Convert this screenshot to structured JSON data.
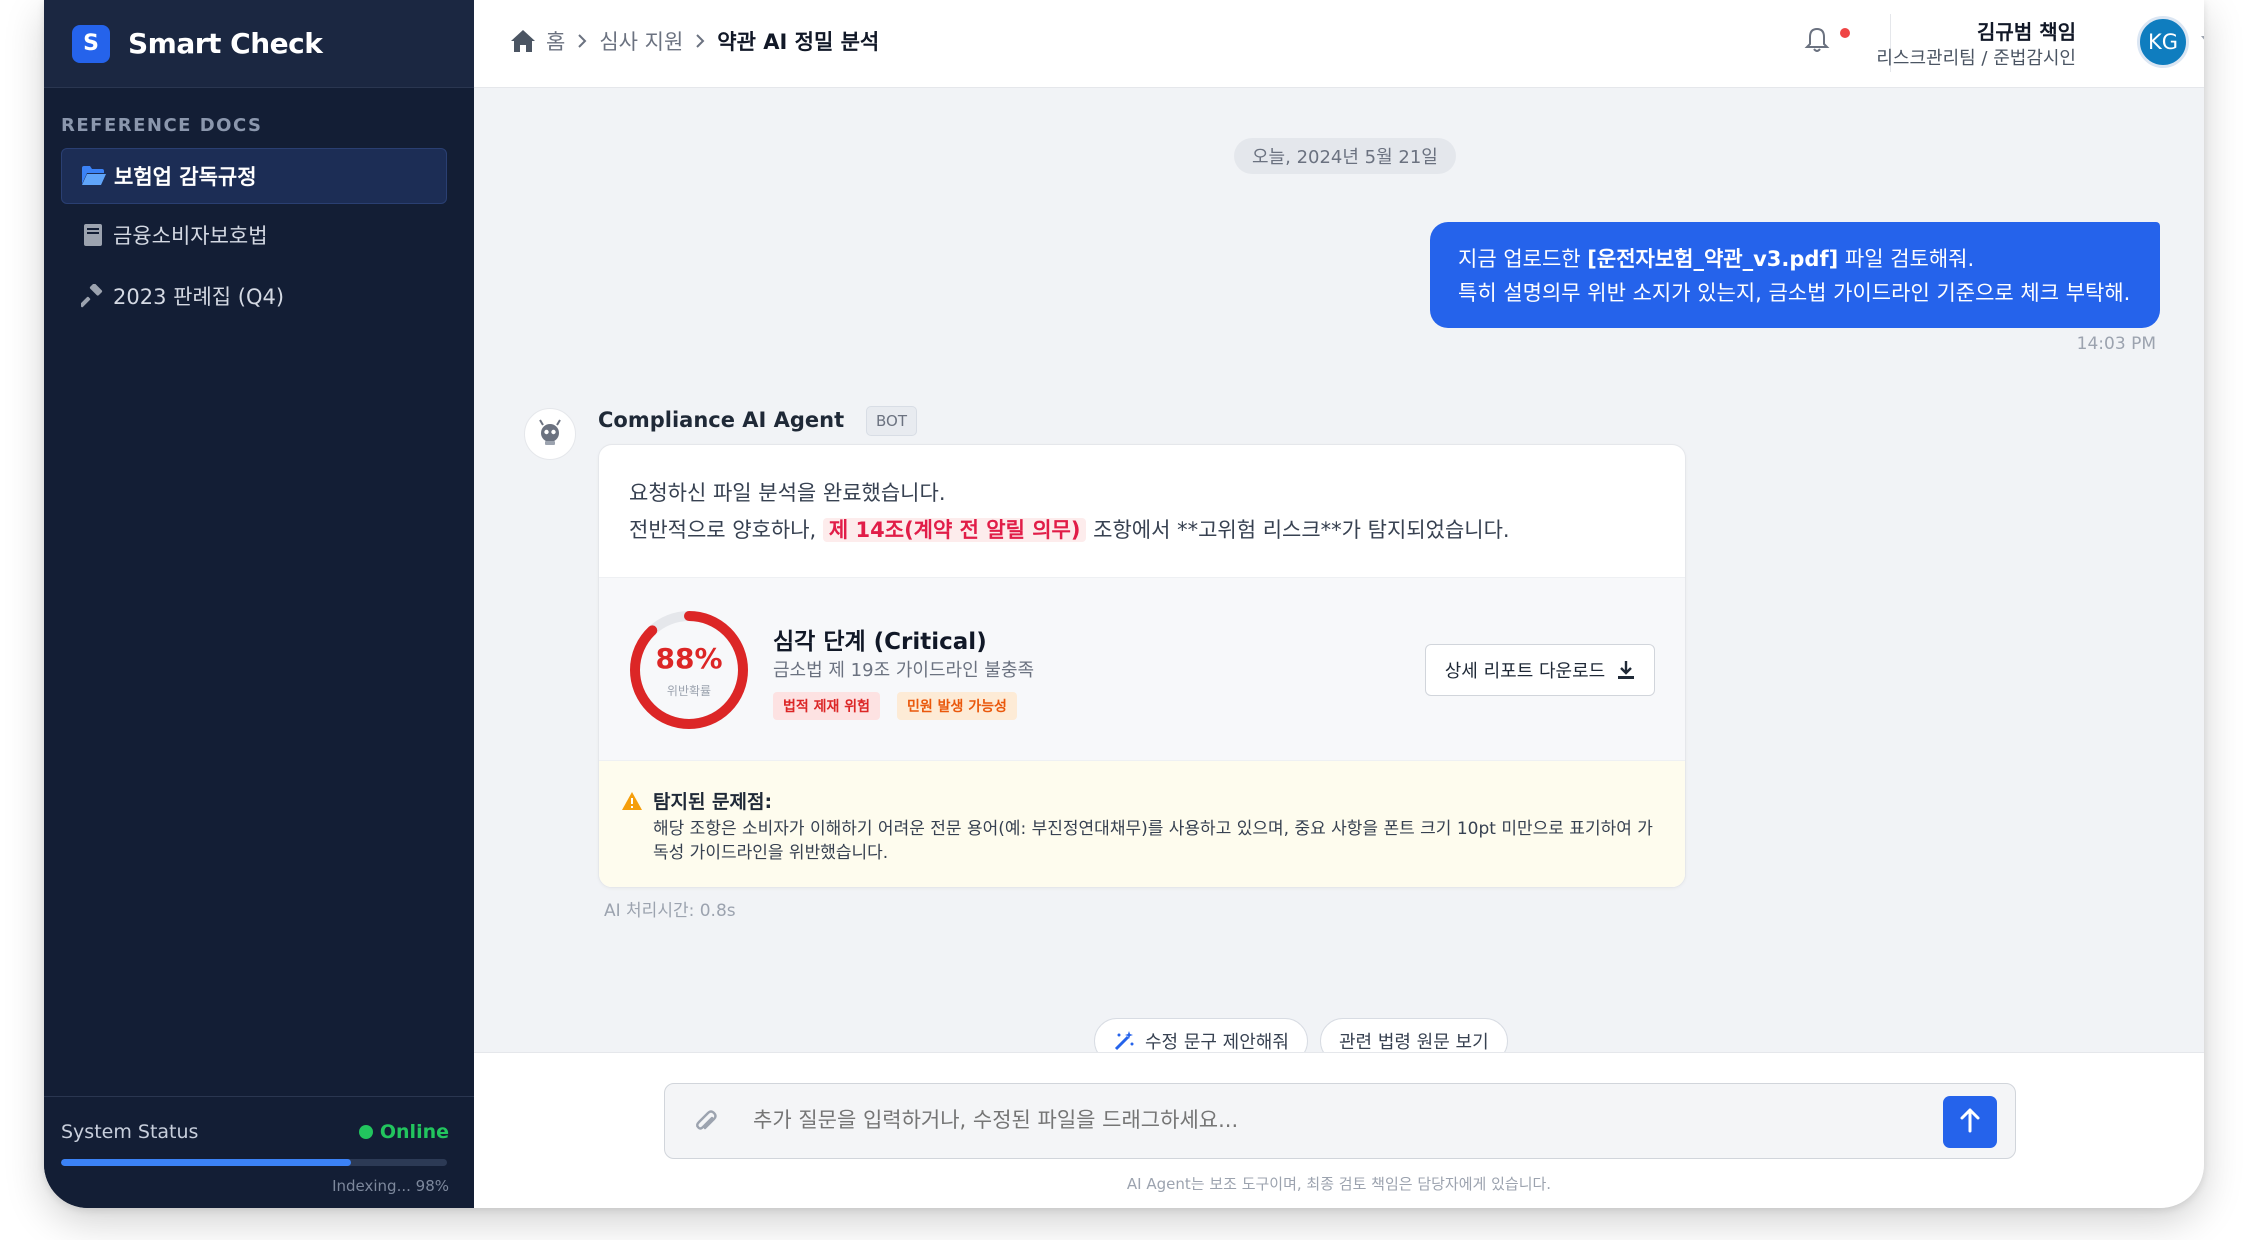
{
  "app": {
    "logo_letter": "S",
    "title": "Smart Check"
  },
  "sidebar": {
    "section_label": "REFERENCE DOCS",
    "items": [
      {
        "label": "보험업 감독규정",
        "icon": "folder-open-icon",
        "active": true
      },
      {
        "label": "금융소비자보호법",
        "icon": "book-icon",
        "active": false
      },
      {
        "label": "2023 판례집 (Q4)",
        "icon": "gavel-icon",
        "active": false
      }
    ],
    "status": {
      "label": "System Status",
      "value": "Online",
      "indexing_text": "Indexing... 98%",
      "indexing_progress": 0.75
    }
  },
  "breadcrumb": {
    "home": "홈",
    "parent": "심사 지원",
    "current": "약관 AI 정밀 분석"
  },
  "user": {
    "name": "김규범 책임",
    "team": "리스크관리팀 / 준법감시인",
    "initials": "KG"
  },
  "chat": {
    "date": "오늘, 2024년 5월 21일",
    "user_message": {
      "line1_prefix": "지금 업로드한 ",
      "line1_file": "[운전자보험_약관_v3.pdf]",
      "line1_suffix": " 파일 검토해줘.",
      "line2": "특히 설명의무 위반 소지가 있는지, 금소법 가이드라인 기준으로 체크 부탁해.",
      "time": "14:03 PM"
    },
    "bot": {
      "name": "Compliance AI Agent",
      "badge": "BOT",
      "line1": "요청하신 파일 분석을 완료했습니다.",
      "line2_prefix": "전반적으로 양호하나, ",
      "line2_highlight": "제 14조(계약 전 알릴 의무)",
      "line2_suffix": " 조항에서 **고위험 리스크**가 탐지되었습니다.",
      "risk": {
        "percent_text": "88%",
        "percent_value": 88,
        "gauge_label": "위반확률",
        "title": "심각 단계 (Critical)",
        "subtitle": "금소법 제 19조 가이드라인 불충족",
        "tags": [
          "법적 제재 위험",
          "민원 발생 가능성"
        ],
        "download_label": "상세 리포트 다운로드"
      },
      "issue": {
        "title": "탐지된 문제점:",
        "body": "해당 조항은 소비자가 이해하기 어려운 전문 용어(예: 부진정연대채무)를 사용하고 있으며, 중요 사항을 폰트 크기 10pt 미만으로 표기하여 가독성 가이드라인을 위반했습니다."
      },
      "processing_time": "AI 처리시간: 0.8s"
    }
  },
  "suggestions": [
    "수정 문구 제안해줘",
    "관련 법령 원문 보기"
  ],
  "composer": {
    "placeholder": "추가 질문을 입력하거나, 수정된 파일을 드래그하세요...",
    "disclaimer": "AI Agent는 보조 도구이며, 최종 검토 책임은 담당자에게 있습니다."
  },
  "colors": {
    "accent": "#2563eb",
    "sidebar_bg": "#131e35",
    "critical": "#dc2626",
    "online": "#22c55e"
  }
}
